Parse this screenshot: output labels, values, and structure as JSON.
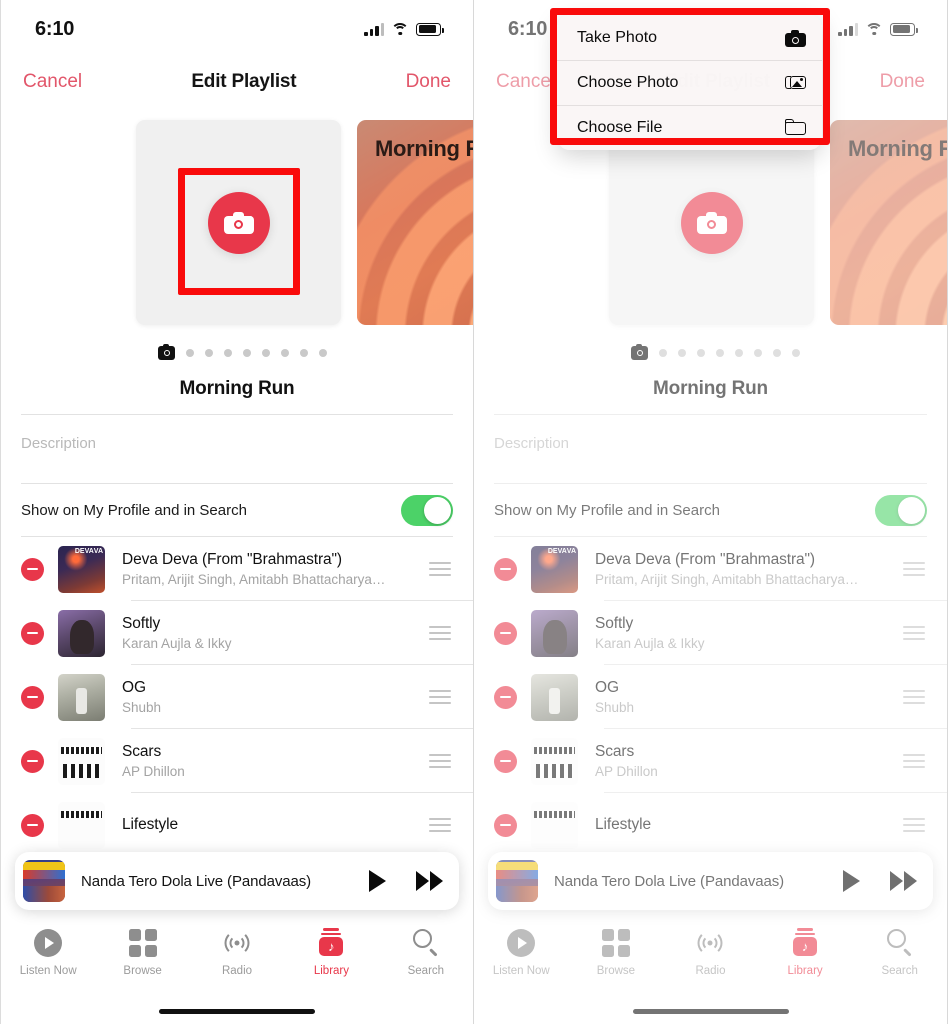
{
  "status_bar": {
    "time": "6:10"
  },
  "nav": {
    "cancel": "Cancel",
    "title": "Edit Playlist",
    "done": "Done"
  },
  "artwork": {
    "camera_button_name": "camera-button",
    "gradient_card_label": "Morning Run",
    "dot_count": 8
  },
  "playlist": {
    "name": "Morning Run",
    "description_placeholder": "Description",
    "show_on_profile_label": "Show on My Profile and in Search",
    "show_on_profile_on": true
  },
  "songs": [
    {
      "title": "Deva Deva (From \"Brahmastra\")",
      "artist": "Pritam, Arijit Singh, Amitabh Bhattacharya…",
      "art": "art-deva"
    },
    {
      "title": "Softly",
      "artist": "Karan Aujla & Ikky",
      "art": "art-softly"
    },
    {
      "title": "OG",
      "artist": "Shubh",
      "art": "art-og"
    },
    {
      "title": "Scars",
      "artist": "AP Dhillon",
      "art": "art-scars"
    },
    {
      "title": "Lifestyle",
      "artist": "",
      "art": "art-life"
    }
  ],
  "mini_player": {
    "title": "Nanda Tero Dola Live (Pandavaas)",
    "play_label": "play-button",
    "next_label": "fast-forward-button"
  },
  "tabs": [
    {
      "label": "Listen Now",
      "icon": "listen-now-icon",
      "active": false
    },
    {
      "label": "Browse",
      "icon": "browse-icon",
      "active": false
    },
    {
      "label": "Radio",
      "icon": "radio-icon",
      "active": false
    },
    {
      "label": "Library",
      "icon": "library-icon",
      "active": true
    },
    {
      "label": "Search",
      "icon": "search-icon",
      "active": false
    }
  ],
  "context_menu": {
    "items": [
      {
        "label": "Take Photo",
        "icon": "camera-icon"
      },
      {
        "label": "Choose Photo",
        "icon": "photos-icon"
      },
      {
        "label": "Choose File",
        "icon": "folder-icon"
      }
    ]
  },
  "annotation": {
    "highlight_color": "#f90b0b",
    "left_target": "camera-button",
    "right_target": "context-menu"
  },
  "colors": {
    "accent_red": "#e8374a",
    "nav_tint": "#e2566a",
    "toggle_green": "#4cd268",
    "inactive_gray": "#9b9b9b"
  }
}
